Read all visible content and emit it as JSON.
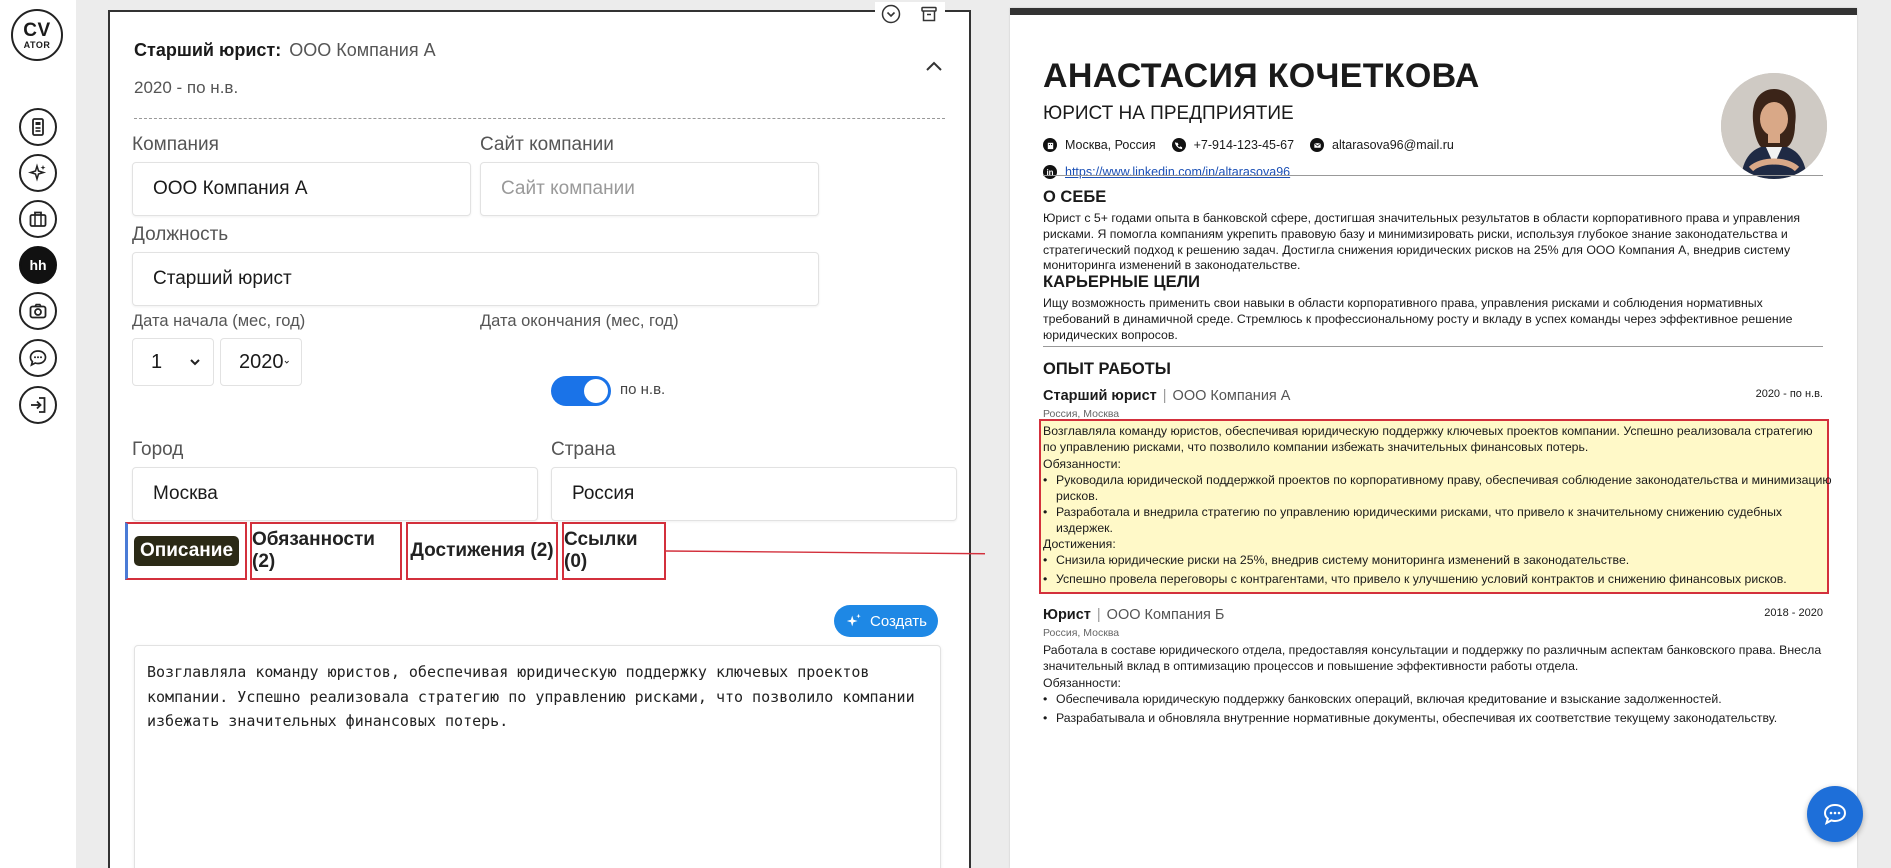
{
  "logo": {
    "line1": "CV",
    "line2": "ATOR"
  },
  "rail": {
    "hh_label": "hh"
  },
  "job": {
    "position": "Старший юрист:",
    "company": "ООО Компания А",
    "dates": "2020 - по н.в."
  },
  "form": {
    "company_label": "Компания",
    "company_value": "ООО Компания А",
    "site_label": "Сайт компании",
    "site_placeholder": "Сайт компании",
    "position_label": "Должность",
    "position_value": "Старший юрист",
    "start_label": "Дата начала (мес, год)",
    "start_month": "1",
    "start_year": "2020",
    "end_label": "Дата окончания (мес, год)",
    "present_label": "по н.в.",
    "city_label": "Город",
    "city_value": "Москва",
    "country_label": "Страна",
    "country_value": "Россия"
  },
  "tabs": [
    {
      "label": "Описание"
    },
    {
      "label": "Обязанности (2)"
    },
    {
      "label": "Достижения (2)"
    },
    {
      "label": "Ссылки (0)"
    }
  ],
  "create_label": "Создать",
  "description_text": "Возглавляла команду юристов, обеспечивая юридическую поддержку ключевых проектов компании. Успешно реализовала стратегию по управлению рисками, что позволило компании избежать значительных финансовых потерь.",
  "resume": {
    "name": "АНАСТАСИЯ КОЧЕТКОВА",
    "role": "ЮРИСТ НА ПРЕДПРИЯТИЕ",
    "location": "Москва, Россия",
    "phone": "+7-914-123-45-67",
    "email": "altarasova96@mail.ru",
    "linkedin": "https://www.linkedin.com/in/altarasova96",
    "about_title": "О СЕБЕ",
    "about_text": "Юрист с 5+ годами опыта в банковской сфере, достигшая значительных результатов в области корпоративного права и управления рисками. Я помогла компаниям укрепить правовую базу и минимизировать риски, используя глубокое знание законодательства и стратегический подход к решению задач. Достигла снижения юридических рисков на 25% для ООО Компания А, внедрив систему мониторинга изменений в законодательстве.",
    "goals_title": "КАРЬЕРНЫЕ ЦЕЛИ",
    "goals_text": "Ищу возможность применить свои навыки в области корпоративного права, управления рисками и соблюдения нормативных требований в динамичной среде. Стремлюсь к профессиональному росту и вкладу в успех команды через эффективное решение юридических вопросов.",
    "exp_title": "ОПЫТ РАБОТЫ",
    "jobs": [
      {
        "position": "Старший юрист",
        "company": "ООО Компания А",
        "dates": "2020 - по н.в.",
        "location": "Россия, Москва",
        "description": "Возглавляла команду юристов, обеспечивая юридическую поддержку ключевых проектов компании. Успешно реализовала стратегию по управлению рисками, что позволило компании избежать значительных финансовых потерь.",
        "duties_label": "Обязанности:",
        "duties": [
          "Руководила юридической поддержкой проектов по корпоративному праву, обеспечивая соблюдение законодательства и минимизацию рисков.",
          "Разработала и внедрила стратегию по управлению юридическими рисками, что привело к значительному снижению судебных издержек."
        ],
        "achievements_label": "Достижения:",
        "achievements": [
          "Снизила юридические риски на 25%, внедрив систему мониторинга изменений в законодательстве.",
          "Успешно провела переговоры с контрагентами, что привело к улучшению условий контрактов и снижению финансовых рисков."
        ]
      },
      {
        "position": "Юрист",
        "company": "ООО Компания Б",
        "dates": "2018 - 2020",
        "location": "Россия, Москва",
        "description": "Работала в составе юридического отдела, предоставляя консультации и поддержку по различным аспектам банковского права. Внесла значительный вклад в оптимизацию процессов и повышение эффективности работы отдела.",
        "duties_label": "Обязанности:",
        "duties": [
          "Обеспечивала юридическую поддержку банковских операций, включая кредитование и взыскание задолженностей.",
          "Разрабатывала и обновляла внутренние нормативные документы, обеспечивая их соответствие текущему законодательству."
        ]
      }
    ]
  },
  "colors": {
    "accent": "#1e88e5",
    "toggle": "#1a73e8",
    "highlight_border": "#d3303c",
    "highlight_fill": "#fff9c8"
  }
}
